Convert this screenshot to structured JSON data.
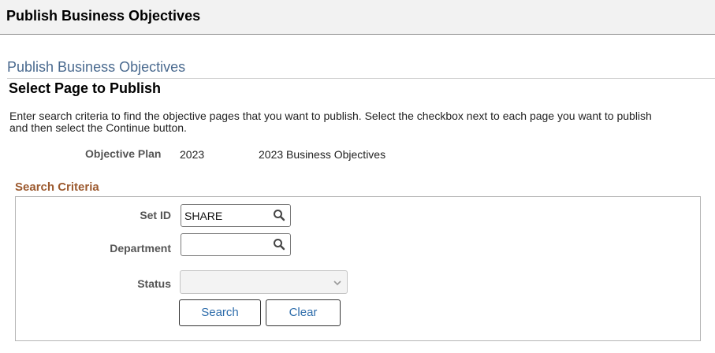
{
  "header": {
    "title": "Publish Business Objectives"
  },
  "page": {
    "subtitle": "Publish Business Objectives",
    "heading": "Select Page to Publish",
    "instructions": "Enter search criteria to find the objective pages that you want to publish. Select the checkbox next to each page you want to publish and then select the Continue button."
  },
  "objective_plan": {
    "label": "Objective Plan",
    "year": "2023",
    "description": "2023 Business Objectives"
  },
  "search_criteria": {
    "title": "Search Criteria",
    "set_id": {
      "label": "Set ID",
      "value": "SHARE",
      "icon": "search-icon"
    },
    "department": {
      "label": "Department",
      "value": "",
      "icon": "search-icon"
    },
    "status": {
      "label": "Status",
      "value": "",
      "icon": "chevron-down-icon"
    },
    "search_label": "Search",
    "clear_label": "Clear"
  },
  "colors": {
    "header_bg": "#f2f2f2",
    "subtitle": "#4a6a8f",
    "section_title": "#9c5a2f",
    "button_text": "#2e6dab"
  }
}
